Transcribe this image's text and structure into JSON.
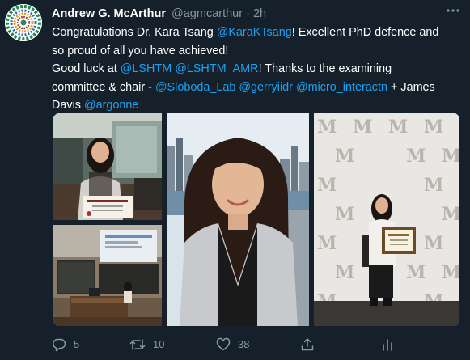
{
  "tweet": {
    "author": {
      "name": "Andrew G. McArthur",
      "handle": "@agmcarthur",
      "separator": "·",
      "time": "2h",
      "avatar_icon": "circular-logo-avatar"
    },
    "more_icon": "more-icon",
    "text": {
      "l1_a": "Congratulations Dr. Kara Tsang ",
      "l1_m1": "@KaraKTsang",
      "l1_b": "! Excellent PhD defence and",
      "l2": "so proud of all you have achieved!",
      "l3_a": "Good luck at ",
      "l3_m1": "@LSHTM",
      "l3_m2": "@LSHTM_AMR",
      "l3_b": "! Thanks to the examining",
      "l4_a": "committee & chair - ",
      "l4_m1": "@Sloboda_Lab",
      "l4_m2": "@gerryiidr",
      "l4_m3": "@micro_interactn",
      "l4_b": " + James",
      "l5_a": "Davis ",
      "l5_m1": "@argonne"
    },
    "photos": [
      {
        "name": "photo-holding-certificate"
      },
      {
        "name": "photo-lecture-hall"
      },
      {
        "name": "photo-portrait-city-skyline"
      },
      {
        "name": "photo-backdrop-certificate"
      }
    ],
    "actions": {
      "reply_count": "5",
      "retweet_count": "10",
      "like_count": "38"
    },
    "colors": {
      "background": "#15202b",
      "text": "#ffffff",
      "muted": "#8899a6",
      "link": "#1da1f2"
    }
  }
}
